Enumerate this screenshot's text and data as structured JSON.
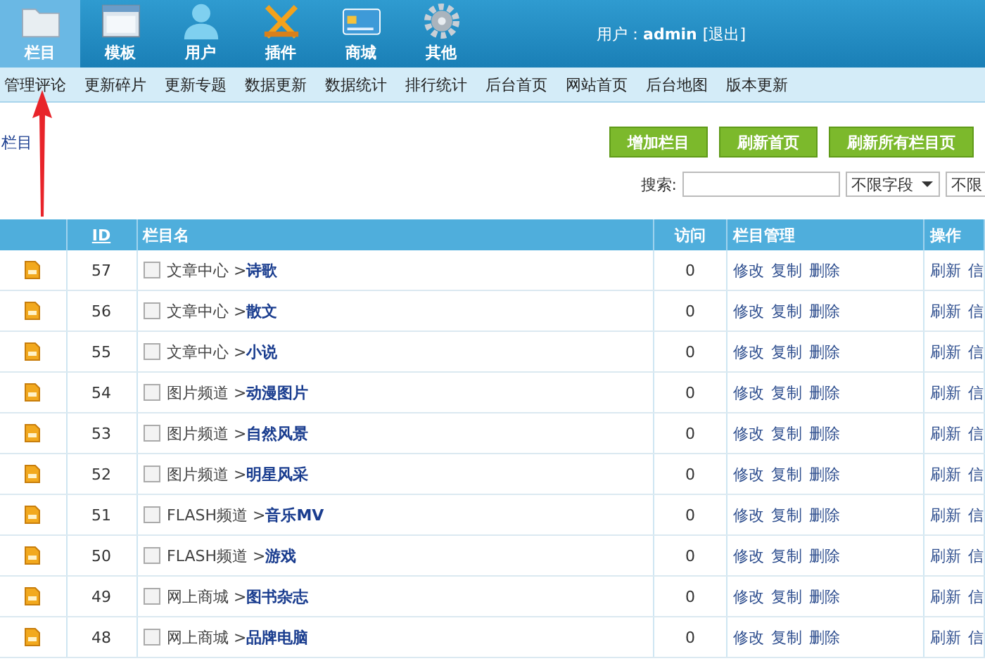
{
  "top_nav": [
    {
      "label": "栏目",
      "selected": true
    },
    {
      "label": "模板",
      "selected": false
    },
    {
      "label": "用户",
      "selected": false
    },
    {
      "label": "插件",
      "selected": false
    },
    {
      "label": "商城",
      "selected": false
    },
    {
      "label": "其他",
      "selected": false
    }
  ],
  "user_info": {
    "label": "用户：",
    "name": "admin",
    "logout": "[退出]"
  },
  "sub_nav": [
    "管理评论",
    "更新碎片",
    "更新专题",
    "数据更新",
    "数据统计",
    "排行统计",
    "后台首页",
    "网站首页",
    "后台地图",
    "版本更新"
  ],
  "breadcrumb": "栏目",
  "buttons": [
    "增加栏目",
    "刷新首页",
    "刷新所有栏目页"
  ],
  "search": {
    "label": "搜索:",
    "field_select": "不限字段",
    "type_select": "不限"
  },
  "table": {
    "columns": [
      "ID",
      "栏目名",
      "访问",
      "栏目管理",
      "操作"
    ],
    "rows": [
      {
        "id": "57",
        "parent": "文章中心 >",
        "name": "诗歌",
        "visits": "0",
        "checked": false,
        "manage": [
          "修改",
          "复制",
          "删除"
        ],
        "actions": [
          "刷新",
          "信"
        ]
      },
      {
        "id": "56",
        "parent": "文章中心 >",
        "name": "散文",
        "visits": "0",
        "checked": false,
        "manage": [
          "修改",
          "复制",
          "删除"
        ],
        "actions": [
          "刷新",
          "信"
        ]
      },
      {
        "id": "55",
        "parent": "文章中心 >",
        "name": "小说",
        "visits": "0",
        "checked": false,
        "manage": [
          "修改",
          "复制",
          "删除"
        ],
        "actions": [
          "刷新",
          "信"
        ]
      },
      {
        "id": "54",
        "parent": "图片频道 >",
        "name": "动漫图片",
        "visits": "0",
        "checked": false,
        "manage": [
          "修改",
          "复制",
          "删除"
        ],
        "actions": [
          "刷新",
          "信"
        ]
      },
      {
        "id": "53",
        "parent": "图片频道 >",
        "name": "自然风景",
        "visits": "0",
        "checked": false,
        "manage": [
          "修改",
          "复制",
          "删除"
        ],
        "actions": [
          "刷新",
          "信"
        ]
      },
      {
        "id": "52",
        "parent": "图片频道 >",
        "name": "明星风采",
        "visits": "0",
        "checked": false,
        "manage": [
          "修改",
          "复制",
          "删除"
        ],
        "actions": [
          "刷新",
          "信"
        ]
      },
      {
        "id": "51",
        "parent": "FLASH频道 >",
        "name": "音乐MV",
        "visits": "0",
        "checked": false,
        "manage": [
          "修改",
          "复制",
          "删除"
        ],
        "actions": [
          "刷新",
          "信"
        ]
      },
      {
        "id": "50",
        "parent": "FLASH频道 >",
        "name": "游戏",
        "visits": "0",
        "checked": false,
        "manage": [
          "修改",
          "复制",
          "删除"
        ],
        "actions": [
          "刷新",
          "信"
        ]
      },
      {
        "id": "49",
        "parent": "网上商城 >",
        "name": "图书杂志",
        "visits": "0",
        "checked": false,
        "manage": [
          "修改",
          "复制",
          "删除"
        ],
        "actions": [
          "刷新",
          "信"
        ]
      },
      {
        "id": "48",
        "parent": "网上商城 >",
        "name": "品牌电脑",
        "visits": "0",
        "checked": false,
        "manage": [
          "修改",
          "复制",
          "删除"
        ],
        "actions": [
          "刷新",
          "信"
        ]
      }
    ]
  }
}
